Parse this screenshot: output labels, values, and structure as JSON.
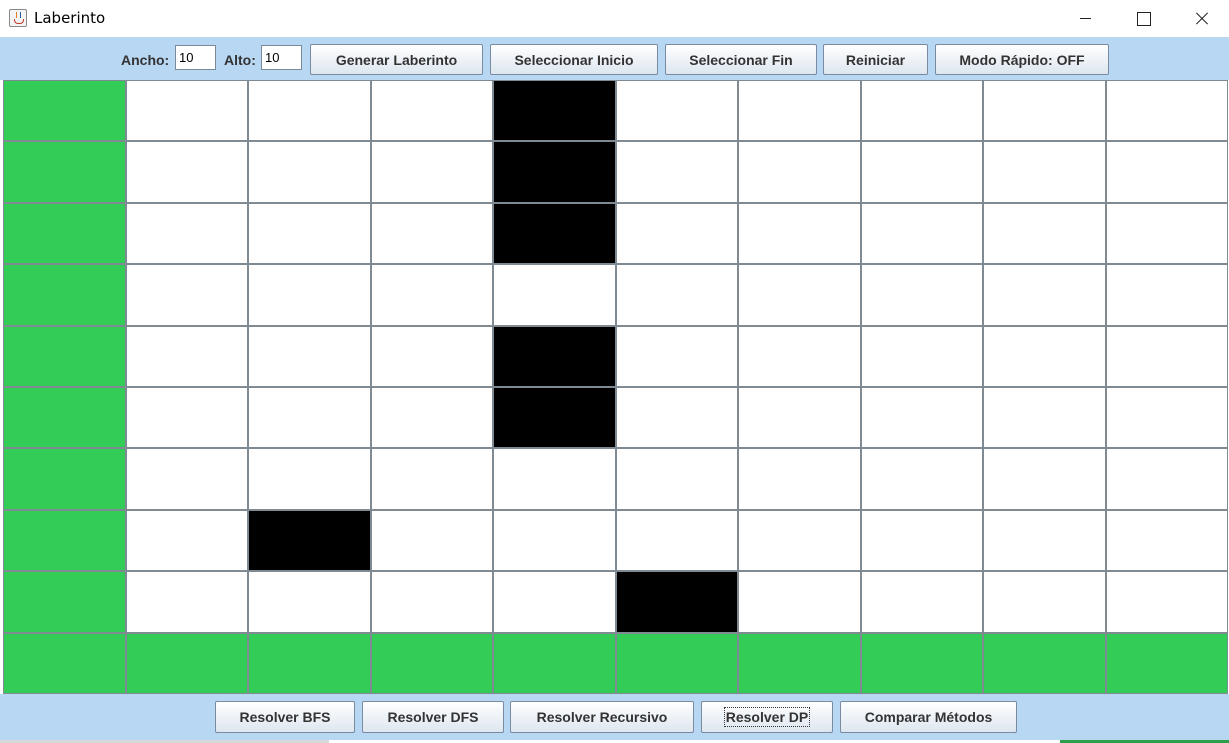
{
  "window": {
    "title": "Laberinto"
  },
  "toolbar": {
    "width_label": "Ancho:",
    "width_value": "10",
    "height_label": "Alto:",
    "height_value": "10",
    "buttons": [
      "Generar Laberinto",
      "Seleccionar Inicio",
      "Seleccionar Fin",
      "Reiniciar",
      "Modo Rápido: OFF"
    ]
  },
  "maze": {
    "columns": 10,
    "rows": 10,
    "legend": {
      "0": "open",
      "1": "wall",
      "2": "path"
    },
    "colors": {
      "open": "#ffffff",
      "wall": "#000000",
      "path": "#33cc57",
      "grid": "#808a93"
    },
    "cells": [
      [
        2,
        0,
        0,
        0,
        1,
        0,
        0,
        0,
        0,
        0
      ],
      [
        2,
        0,
        0,
        0,
        1,
        0,
        0,
        0,
        0,
        0
      ],
      [
        2,
        0,
        0,
        0,
        1,
        0,
        0,
        0,
        0,
        0
      ],
      [
        2,
        0,
        0,
        0,
        0,
        0,
        0,
        0,
        0,
        0
      ],
      [
        2,
        0,
        0,
        0,
        1,
        0,
        0,
        0,
        0,
        0
      ],
      [
        2,
        0,
        0,
        0,
        1,
        0,
        0,
        0,
        0,
        0
      ],
      [
        2,
        0,
        0,
        0,
        0,
        0,
        0,
        0,
        0,
        0
      ],
      [
        2,
        0,
        1,
        0,
        0,
        0,
        0,
        0,
        0,
        0
      ],
      [
        2,
        0,
        0,
        0,
        0,
        1,
        0,
        0,
        0,
        0
      ],
      [
        2,
        2,
        2,
        2,
        2,
        2,
        2,
        2,
        2,
        2
      ]
    ]
  },
  "bottom": {
    "buttons": [
      "Resolver BFS",
      "Resolver DFS",
      "Resolver Recursivo",
      "Resolver DP",
      "Comparar Métodos"
    ],
    "focused": "Resolver DP"
  },
  "colors": {
    "toolbar_bg": "#b8d7f3",
    "accent_green": "#33cc57"
  }
}
